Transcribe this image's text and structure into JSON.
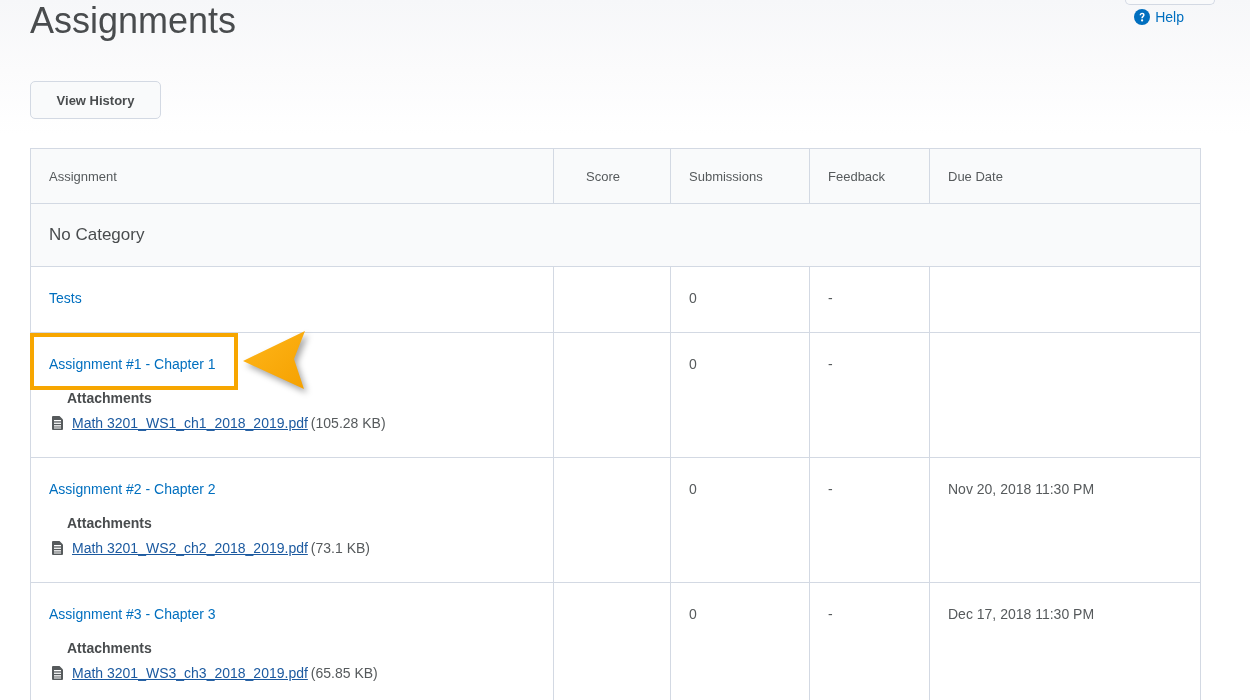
{
  "header": {
    "title": "Assignments",
    "help_link": "Help",
    "buttons": [
      "View History"
    ]
  },
  "table": {
    "columns": [
      "Assignment",
      "Score",
      "Submissions",
      "Feedback",
      "Due Date"
    ],
    "category": "No Category",
    "rows": [
      {
        "name": "Tests",
        "submissions": "0",
        "feedback": "-",
        "highlighted": false
      },
      {
        "name": "Assignment #1 - Chapter 1",
        "submissions": "0",
        "feedback": "-",
        "highlighted": true,
        "attachments_label": "Attachments",
        "attachments": [
          {
            "file": "Math 3201_WS1_ch1_2018_2019.pdf",
            "size": "(105.28 KB)"
          }
        ]
      },
      {
        "name": "Assignment #2 - Chapter 2",
        "submissions": "0",
        "feedback": "-",
        "due_date": "Nov 20, 2018 11:30 PM",
        "highlighted": false,
        "attachments_label": "Attachments",
        "attachments": [
          {
            "file": "Math 3201_WS2_ch2_2018_2019.pdf",
            "size": "(73.1 KB)"
          }
        ]
      },
      {
        "name": "Assignment #3 - Chapter 3",
        "submissions": "0",
        "feedback": "-",
        "due_date": "Dec 17, 2018 11:30 PM",
        "highlighted": false,
        "attachments_label": "Attachments",
        "attachments": [
          {
            "file": "Math 3201_WS3_ch3_2018_2019.pdf",
            "size": "(65.85 KB)"
          }
        ]
      }
    ]
  }
}
